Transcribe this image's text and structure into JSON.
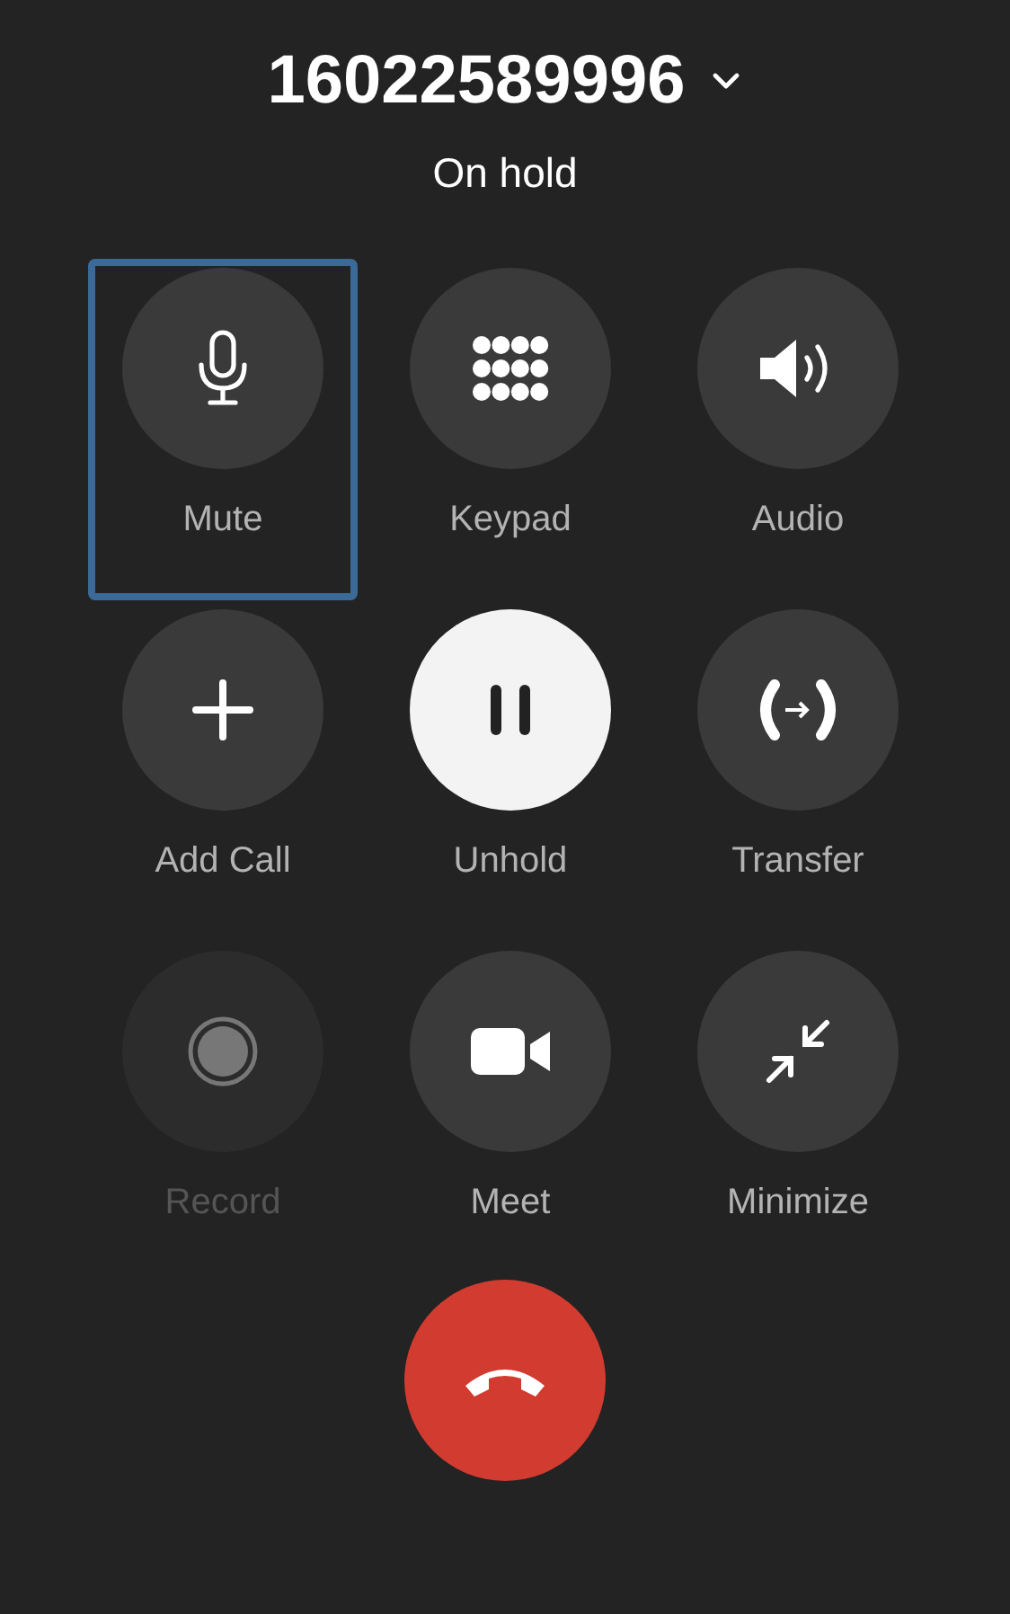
{
  "header": {
    "number": "16022589996",
    "status": "On hold"
  },
  "buttons": [
    {
      "label": "Mute",
      "kind": "normal",
      "focused": true,
      "disabled": false
    },
    {
      "label": "Keypad",
      "kind": "normal",
      "focused": false,
      "disabled": false
    },
    {
      "label": "Audio",
      "kind": "normal",
      "focused": false,
      "disabled": false
    },
    {
      "label": "Add Call",
      "kind": "normal",
      "focused": false,
      "disabled": false
    },
    {
      "label": "Unhold",
      "kind": "highlighted",
      "focused": false,
      "disabled": false
    },
    {
      "label": "Transfer",
      "kind": "normal",
      "focused": false,
      "disabled": false
    },
    {
      "label": "Record",
      "kind": "normal",
      "focused": false,
      "disabled": true
    },
    {
      "label": "Meet",
      "kind": "normal",
      "focused": false,
      "disabled": false
    },
    {
      "label": "Minimize",
      "kind": "normal",
      "focused": false,
      "disabled": false
    }
  ]
}
